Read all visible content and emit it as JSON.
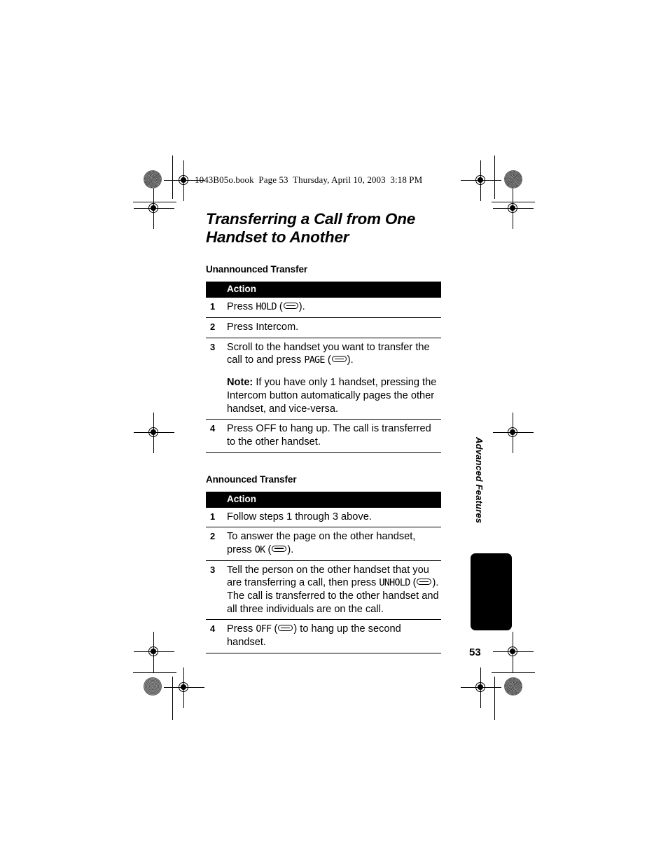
{
  "header": {
    "running_head": "1043B05o.book  Page 53  Thursday, April 10, 2003  3:18 PM"
  },
  "page": {
    "title": "Transferring a Call from One Handset to Another",
    "number": "53",
    "side_tab": "Advanced Features"
  },
  "sections": [
    {
      "heading": "Unannounced Transfer",
      "column_header": "Action",
      "steps": [
        {
          "num": "1",
          "parts": [
            {
              "type": "text",
              "value": "Press "
            },
            {
              "type": "lcd",
              "value": "HOLD"
            },
            {
              "type": "text",
              "value": " ("
            },
            {
              "type": "softkey"
            },
            {
              "type": "text",
              "value": ")."
            }
          ]
        },
        {
          "num": "2",
          "parts": [
            {
              "type": "text",
              "value": "Press Intercom."
            }
          ]
        },
        {
          "num": "3",
          "parts": [
            {
              "type": "text",
              "value": "Scroll to the handset you want to transfer the call to and press "
            },
            {
              "type": "lcd",
              "value": "PAGE"
            },
            {
              "type": "text",
              "value": " ("
            },
            {
              "type": "softkey"
            },
            {
              "type": "text",
              "value": ")."
            }
          ],
          "note": {
            "label": "Note:",
            "text": " If you have only 1 handset, pressing the Intercom button automatically pages the other handset, and vice-versa."
          }
        },
        {
          "num": "4",
          "parts": [
            {
              "type": "text",
              "value": "Press OFF to hang up. The call is transferred to the other handset."
            }
          ]
        }
      ]
    },
    {
      "heading": "Announced Transfer",
      "column_header": "Action",
      "steps": [
        {
          "num": "1",
          "parts": [
            {
              "type": "text",
              "value": "Follow steps 1 through 3 above."
            }
          ]
        },
        {
          "num": "2",
          "parts": [
            {
              "type": "text",
              "value": "To answer the page on the other handset, press "
            },
            {
              "type": "lcd",
              "value": "OK"
            },
            {
              "type": "text",
              "value": " ("
            },
            {
              "type": "softkey"
            },
            {
              "type": "text",
              "value": ")."
            }
          ]
        },
        {
          "num": "3",
          "parts": [
            {
              "type": "text",
              "value": "Tell the person on the other handset that you are transferring a call, then press "
            },
            {
              "type": "lcd",
              "value": "UNHOLD"
            },
            {
              "type": "text",
              "value": " ("
            },
            {
              "type": "softkey"
            },
            {
              "type": "text",
              "value": "). The call is transferred to the other handset and all three individuals are on the call."
            }
          ]
        },
        {
          "num": "4",
          "parts": [
            {
              "type": "text",
              "value": "Press "
            },
            {
              "type": "lcd",
              "value": "OFF"
            },
            {
              "type": "text",
              "value": " ("
            },
            {
              "type": "softkey"
            },
            {
              "type": "text",
              "value": ") to hang up the second handset."
            }
          ]
        }
      ]
    }
  ],
  "colors": {
    "ink": "#000000",
    "paper": "#ffffff",
    "header_bar": "#000000"
  }
}
